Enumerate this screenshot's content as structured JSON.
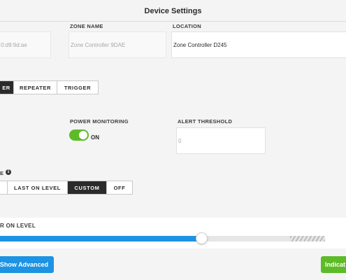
{
  "header": {
    "title": "Device Settings"
  },
  "fields": {
    "mac": {
      "value": "0:d9:9d:ae"
    },
    "zone_name": {
      "label": "ZONE NAME",
      "placeholder": "Zone Controller 9DAE"
    },
    "location": {
      "label": "LOCATION",
      "value": "Zone Controller D245"
    }
  },
  "mode_selector": {
    "options": [
      "ER",
      "REPEATER",
      "TRIGGER"
    ],
    "selected": "ER"
  },
  "power_monitoring": {
    "label": "POWER MONITORING",
    "state_label": "ON",
    "enabled": true
  },
  "alert_threshold": {
    "label": "ALERT THRESHOLD",
    "placeholder": "0"
  },
  "on_level_mode": {
    "label": "E",
    "options": [
      "",
      "LAST ON LEVEL",
      "CUSTOM",
      "OFF"
    ],
    "selected": "CUSTOM"
  },
  "on_level": {
    "label": "R ON LEVEL",
    "value_fraction": 0.62
  },
  "buttons": {
    "show_advanced": "Show Advanced",
    "indicate": "Indicat"
  },
  "colors": {
    "accent_blue": "#1c93e3",
    "accent_green": "#5dbb28",
    "dark": "#2b2b2b"
  }
}
